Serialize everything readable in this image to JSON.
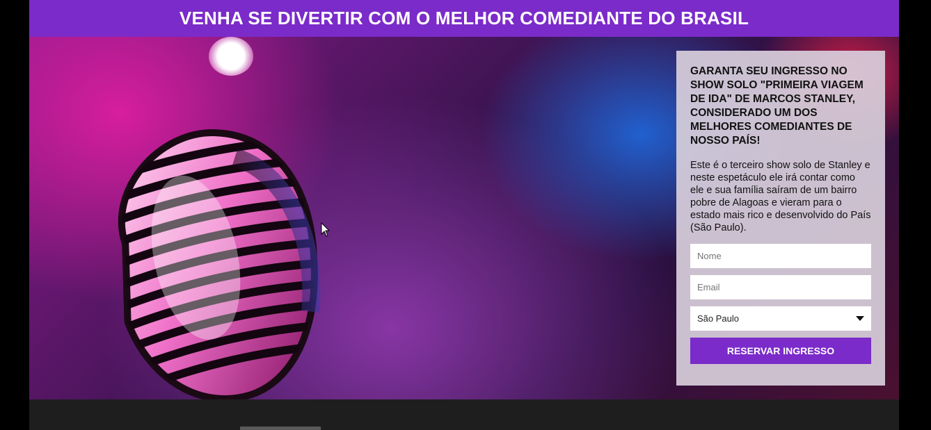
{
  "header": {
    "title": "VENHA SE DIVERTIR COM O MELHOR COMEDIANTE DO BRASIL",
    "background": "#7b2bc9"
  },
  "hero": {
    "image_subject": "microphone-on-stage"
  },
  "form": {
    "heading": "GARANTA SEU INGRESSO NO SHOW SOLO \"PRIMEIRA VIAGEM DE IDA\" DE MARCOS STANLEY, CONSIDERADO UM DOS MELHORES COMEDIANTES DE NOSSO PAÍS!",
    "description": "Este é o terceiro show solo de Stanley e neste espetáculo ele irá contar como ele e sua família saíram de um bairro pobre de Alagoas e vieram para o estado mais rico e desenvolvido do País (São Paulo).",
    "name_placeholder": "Nome",
    "email_placeholder": "Email",
    "state_selected": "São Paulo",
    "submit_label": "RESERVAR INGRESSO",
    "accent": "#7b2bc9"
  }
}
